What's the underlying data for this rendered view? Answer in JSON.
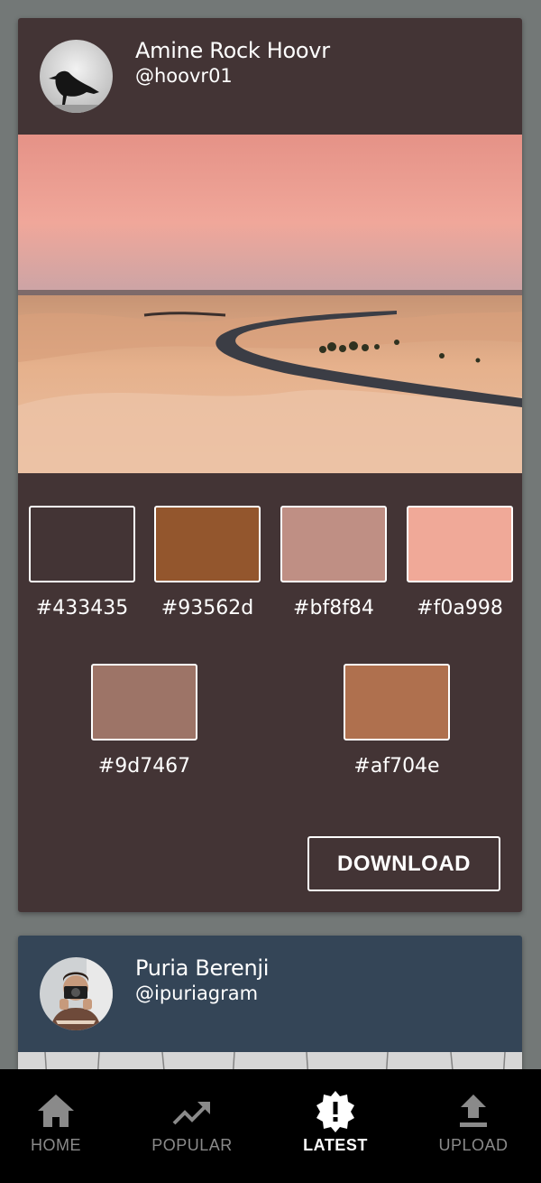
{
  "posts": [
    {
      "author_name": "Amine Rock Hoovr",
      "author_handle": "@hoovr01",
      "card_color": "#433435",
      "photo_subject": "desert-road-at-dusk",
      "palette": [
        {
          "hex": "#433435",
          "color": "#433435"
        },
        {
          "hex": "#93562d",
          "color": "#93562d"
        },
        {
          "hex": "#bf8f84",
          "color": "#bf8f84"
        },
        {
          "hex": "#f0a998",
          "color": "#f0a998"
        },
        {
          "hex": "#9d7467",
          "color": "#9d7467"
        },
        {
          "hex": "#af704e",
          "color": "#af704e"
        }
      ],
      "download_label": "DOWNLOAD"
    },
    {
      "author_name": "Puria Berenji",
      "author_handle": "@ipuriagram",
      "card_color": "#344557"
    }
  ],
  "nav": {
    "items": [
      {
        "label": "HOME",
        "icon": "home-icon",
        "active": false
      },
      {
        "label": "POPULAR",
        "icon": "trending-up-icon",
        "active": false
      },
      {
        "label": "LATEST",
        "icon": "new-badge-icon",
        "active": true
      },
      {
        "label": "UPLOAD",
        "icon": "upload-icon",
        "active": false
      }
    ]
  }
}
